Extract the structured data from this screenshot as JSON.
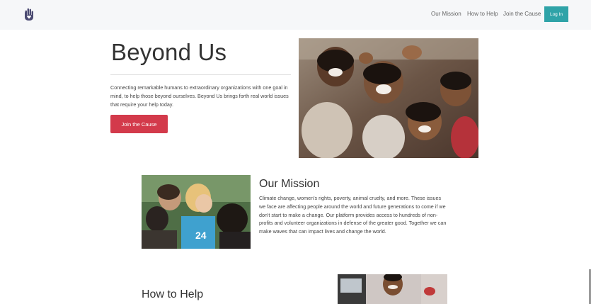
{
  "header": {
    "logo_icon": "hand-heart-icon",
    "nav": [
      "Our Mission",
      "How to Help",
      "Join the Cause"
    ],
    "login_label": "Log In",
    "accent_color": "#2fa3a8"
  },
  "hero": {
    "title": "Beyond Us",
    "description": "Connecting remarkable humans to extraordinary organizations with one goal in mind, to help those beyond ourselves. Beyond Us brings forth real world issues that require your help today.",
    "cta_label": "Join the Cause",
    "cta_color": "#d33a4b"
  },
  "mission": {
    "title": "Our Mission",
    "description": "Climate change, women's rights, poverty, animal cruelty, and more. These issues we face are affecting people around the world and future generations to come if we don't start to make a change. Our platform provides access to hundreds of non-profits and volunteer organizations in defense of the greater good. Together we can make waves that can impact lives and change the world."
  },
  "help": {
    "title": "How to Help"
  }
}
